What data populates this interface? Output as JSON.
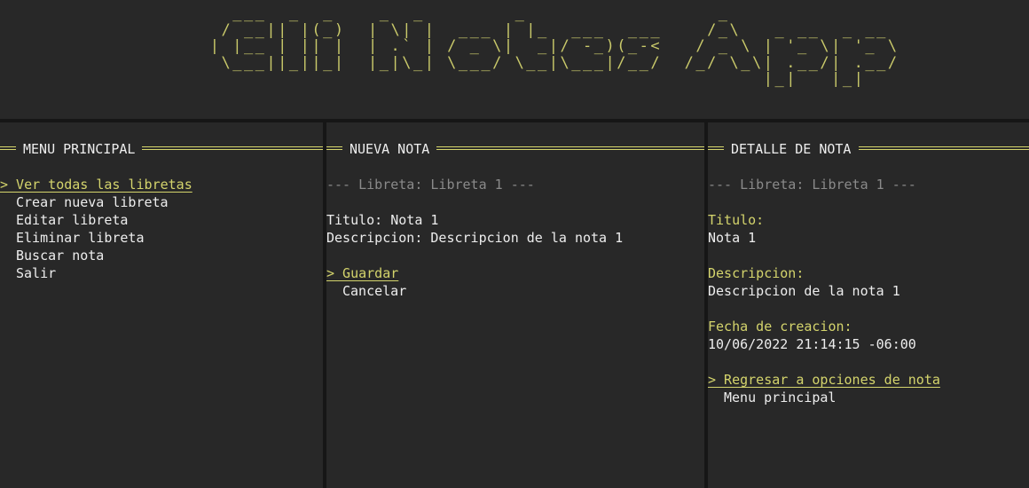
{
  "app": {
    "title": "Cli Notes App",
    "banner_art": "   ___  _  _    _  _        _                 _\n  / __|| |(_)  | \\| |  ___ | |_  ___  ___    /_\\   _ __  _ __\n | |__ | || |  | .` | / _ \\|  _|/ -_)(_-<   / _ \\ | '_ \\| '_ \\\n  \\___||_||_|  |_|\\_| \\___/ \\__|\\___|/__/  /_/ \\_\\| .__/| .__/\n                                                  |_|   |_|"
  },
  "menu": {
    "title": "MENU PRINCIPAL",
    "items": [
      {
        "label": "> Ver todas las libretas",
        "selected": true
      },
      {
        "label": "Crear nueva libreta",
        "selected": false
      },
      {
        "label": "Editar libreta",
        "selected": false
      },
      {
        "label": "Eliminar libreta",
        "selected": false
      },
      {
        "label": "Buscar nota",
        "selected": false
      },
      {
        "label": "Salir",
        "selected": false
      }
    ]
  },
  "new_note": {
    "title": "NUEVA NOTA",
    "notebook_header": "--- Libreta: Libreta 1 ---",
    "title_field": "Titulo: Nota 1",
    "description_field": "Descripcion: Descripcion de la nota 1",
    "actions": [
      {
        "label": "> Guardar",
        "selected": true
      },
      {
        "label": "Cancelar",
        "selected": false
      }
    ]
  },
  "detail": {
    "title": "DETALLE DE NOTA",
    "notebook_header": "--- Libreta: Libreta 1 ---",
    "title_label": "Titulo:",
    "title_value": "Nota 1",
    "description_label": "Descripcion:",
    "description_value": "Descripcion de la nota 1",
    "created_label": "Fecha de creacion:",
    "created_value": "10/06/2022 21:14:15 -06:00",
    "actions": [
      {
        "label": "> Regresar a opciones de nota",
        "selected": true
      },
      {
        "label": "Menu principal",
        "selected": false
      }
    ]
  },
  "colors": {
    "accent": "#d4d46c",
    "background": "#282828",
    "separator": "#161616",
    "muted": "#8a8a8a",
    "text": "#ededed"
  }
}
